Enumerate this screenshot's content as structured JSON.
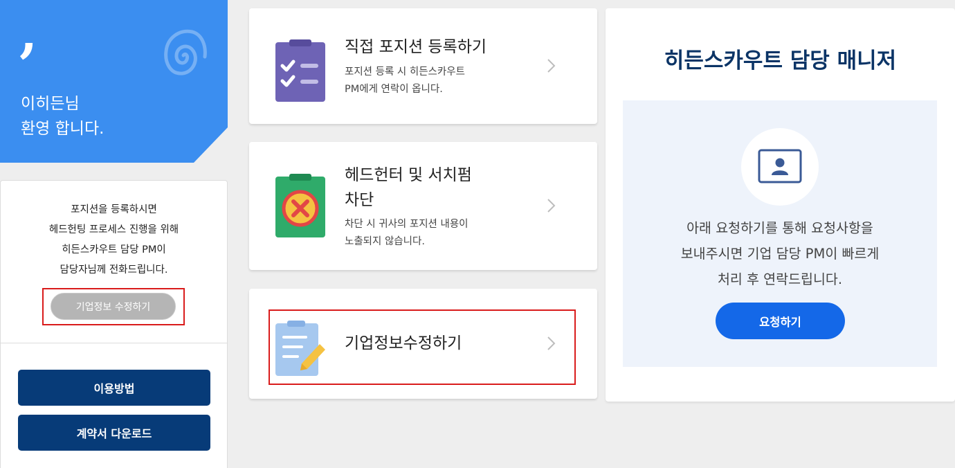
{
  "sidebar": {
    "quote_mark": ",",
    "greeting_line1": "이히든님",
    "greeting_line2": "환영 합니다.",
    "info_lines": [
      "포지션을 등록하시면",
      "헤드헌팅 프로세스 진행을 위해",
      "히든스카우트 담당 PM이",
      "담당자님께 전화드립니다."
    ],
    "edit_company_button": "기업정보 수정하기",
    "how_to_button": "이용방법",
    "contract_download_button": "계약서 다운로드"
  },
  "actions": [
    {
      "title_lines": [
        "직접 포지션 등록하기"
      ],
      "desc_lines": [
        "포지션 등록 시 히든스카우트",
        "PM에게 연락이 옵니다."
      ],
      "icon": "clipboard-checklist-icon"
    },
    {
      "title_lines": [
        "헤드헌터 및 서치펌",
        "차단"
      ],
      "desc_lines": [
        "차단 시 귀사의 포지션 내용이",
        "노출되지 않습니다."
      ],
      "icon": "clipboard-block-icon"
    },
    {
      "title_lines": [
        "기업정보수정하기"
      ],
      "desc_lines": [],
      "icon": "clipboard-edit-icon"
    }
  ],
  "manager": {
    "title": "히든스카우트 담당 매니저",
    "text_lines": [
      "아래 요청하기를 통해 요청사항을",
      "보내주시면 기업 담당 PM이 빠르게",
      "처리 후 연락드립니다."
    ],
    "request_button": "요청하기",
    "icon": "profile-card-icon"
  },
  "colors": {
    "brand_blue": "#3b8ef0",
    "navy": "#073b78",
    "request_blue": "#1468e8",
    "highlight_red": "#d91b1b",
    "title_navy": "#0b3466"
  }
}
